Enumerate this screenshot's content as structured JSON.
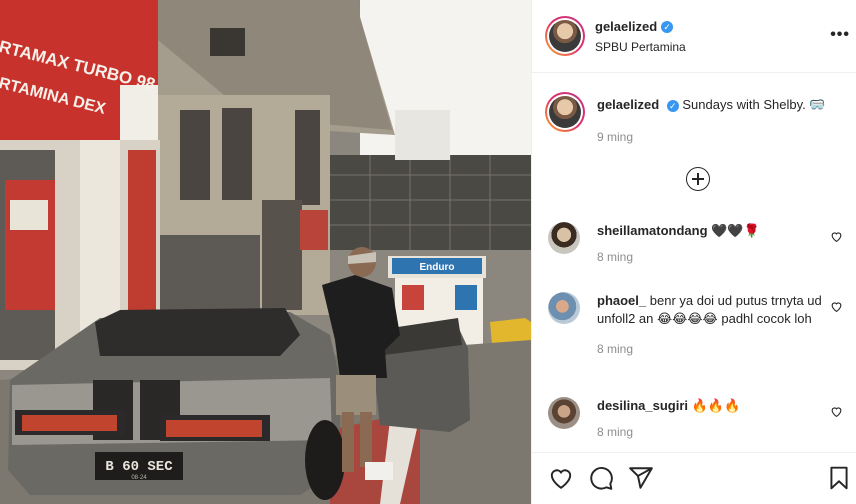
{
  "post": {
    "username": "gelaelized",
    "location": "SPBU Pertamina",
    "more_label": "•••",
    "caption": "Sundays with Shelby.",
    "caption_emoji": "🥽",
    "caption_time": "9 ming"
  },
  "photo": {
    "sign_line1": "RTAMAX TURBO 98",
    "sign_line2": "RTAMINA DEX",
    "plate_main": "B 60 SEC",
    "plate_sub": "08·24",
    "enduro_sign": "Enduro"
  },
  "comments": [
    {
      "username": "sheillamatondang",
      "text": "🖤🖤🌹",
      "time": "8 ming"
    },
    {
      "username": "phaoel_",
      "text": "benr ya doi ud putus trnyta ud unfoll2 an 😂😂😂😂 padhl cocok loh",
      "time": "8 ming"
    },
    {
      "username": "desilina_sugiri",
      "text": "🔥🔥🔥",
      "time": "8 ming"
    }
  ],
  "icons": {
    "verified": "verified-badge-icon",
    "load_more": "plus-circle-icon",
    "like": "heart-icon",
    "comment": "comment-icon",
    "share": "share-icon",
    "save": "bookmark-icon"
  },
  "colors": {
    "verified": "#3897f0",
    "pertamina_red": "#c8322c"
  }
}
